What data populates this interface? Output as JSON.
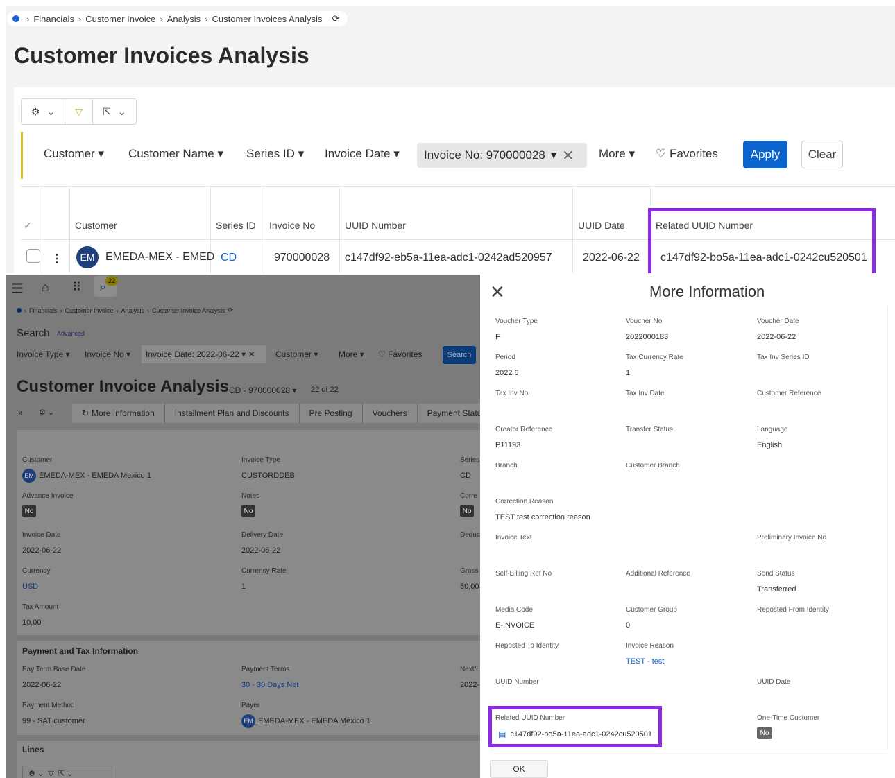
{
  "top": {
    "breadcrumb": [
      "Financials",
      "Customer Invoice",
      "Analysis",
      "Customer Invoices Analysis"
    ],
    "title": "Customer Invoices Analysis",
    "filters": {
      "customer": "Customer",
      "customer_name": "Customer Name",
      "series_id": "Series ID",
      "invoice_date": "Invoice Date",
      "invoice_no_chip": "Invoice No: 970000028",
      "more": "More",
      "favorites": "Favorites",
      "apply": "Apply",
      "clear": "Clear"
    },
    "columns": [
      "Customer",
      "Series ID",
      "Invoice No",
      "UUID Number",
      "UUID Date",
      "Related UUID Number"
    ],
    "row": {
      "avatar": "EM",
      "customer": "EMEDA-MEX - EMED",
      "series_id": "CD",
      "invoice_no": "970000028",
      "uuid_number": "c147df92-eb5a-11ea-adc1-0242ad520957",
      "uuid_date": "2022-06-22",
      "related_uuid": "c147df92-bo5a-11ea-adc1-0242cu520501"
    },
    "highlight_color": "#8a2be2"
  },
  "bottom": {
    "notification_count": "22",
    "breadcrumb": [
      "Financials",
      "Customer Invoice",
      "Analysis",
      "Customer Invoice Analysis"
    ],
    "search": {
      "label": "Search",
      "advanced": "Advanced"
    },
    "filters": {
      "invoice_type": "Invoice Type",
      "invoice_no": "Invoice No",
      "invoice_date_chip": "Invoice Date: 2022-06-22",
      "customer": "Customer",
      "more": "More",
      "favorites": "Favorites",
      "search_button": "Search"
    },
    "page_title": "Customer Invoice Analysis",
    "record": "CD - 970000028",
    "record_count": "22 of 22",
    "tabs": [
      "More Information",
      "Installment Plan and Discounts",
      "Pre Posting",
      "Vouchers",
      "Payment Status"
    ],
    "fields": {
      "customer_label": "Customer",
      "customer_avatar": "EM",
      "customer_value": "EMEDA-MEX - EMEDA Mexico 1",
      "invoice_type_label": "Invoice Type",
      "invoice_type_value": "CUSTORDDEB",
      "series_label": "Series",
      "series_value": "CD",
      "advance_invoice_label": "Advance Invoice",
      "advance_invoice_value": "No",
      "notes_label": "Notes",
      "notes_value": "No",
      "correction_label": "Corre",
      "correction_value": "No",
      "invoice_date_label": "Invoice Date",
      "invoice_date_value": "2022-06-22",
      "delivery_date_label": "Delivery Date",
      "delivery_date_value": "2022-06-22",
      "deduct_label": "Deduc",
      "currency_label": "Currency",
      "currency_value": "USD",
      "currency_rate_label": "Currency Rate",
      "currency_rate_value": "1",
      "gross_label": "Gross",
      "gross_value": "50,00",
      "tax_amount_label": "Tax Amount",
      "tax_amount_value": "10,00"
    },
    "payment": {
      "heading": "Payment and Tax Information",
      "pay_term_label": "Pay Term Base Date",
      "pay_term_value": "2022-06-22",
      "payment_terms_label": "Payment Terms",
      "payment_terms_value": "30 - 30 Days Net",
      "next_label": "Next/L",
      "next_value": "2022-",
      "payment_method_label": "Payment Method",
      "payment_method_value": "99 - SAT customer",
      "payer_label": "Payer",
      "payer_avatar": "EM",
      "payer_value": "EMEDA-MEX - EMEDA Mexico 1"
    },
    "lines_heading": "Lines"
  },
  "dialog": {
    "title": "More Information",
    "ok": "OK",
    "voucher_type_label": "Voucher Type",
    "voucher_type_value": "F",
    "voucher_no_label": "Voucher No",
    "voucher_no_value": "2022000183",
    "voucher_date_label": "Voucher Date",
    "voucher_date_value": "2022-06-22",
    "period_label": "Period",
    "period_value": "2022 6",
    "tax_currency_rate_label": "Tax Currency Rate",
    "tax_currency_rate_value": "1",
    "tax_inv_series_label": "Tax Inv Series ID",
    "tax_inv_no_label": "Tax Inv No",
    "tax_inv_date_label": "Tax Inv Date",
    "customer_reference_label": "Customer Reference",
    "creator_reference_label": "Creator Reference",
    "creator_reference_value": "P11193",
    "transfer_status_label": "Transfer Status",
    "language_label": "Language",
    "language_value": "English",
    "branch_label": "Branch",
    "customer_branch_label": "Customer Branch",
    "correction_reason_label": "Correction Reason",
    "correction_reason_value": "TEST test correction reason",
    "invoice_text_label": "Invoice Text",
    "preliminary_invoice_label": "Preliminary Invoice No",
    "self_billing_label": "Self-Billing Ref No",
    "additional_reference_label": "Additional Reference",
    "send_status_label": "Send Status",
    "send_status_value": "Transferred",
    "media_code_label": "Media Code",
    "media_code_value": "E-INVOICE",
    "customer_group_label": "Customer Group",
    "customer_group_value": "0",
    "reposted_from_label": "Reposted From Identity",
    "reposted_to_label": "Reposted To Identity",
    "invoice_reason_label": "Invoice Reason",
    "invoice_reason_value": "TEST - test",
    "uuid_number_label": "UUID Number",
    "uuid_date_label": "UUID Date",
    "related_uuid_label": "Related UUID Number",
    "related_uuid_value": "c147df92-bo5a-11ea-adc1-0242cu520501",
    "one_time_customer_label": "One-Time Customer",
    "one_time_customer_value": "No"
  }
}
